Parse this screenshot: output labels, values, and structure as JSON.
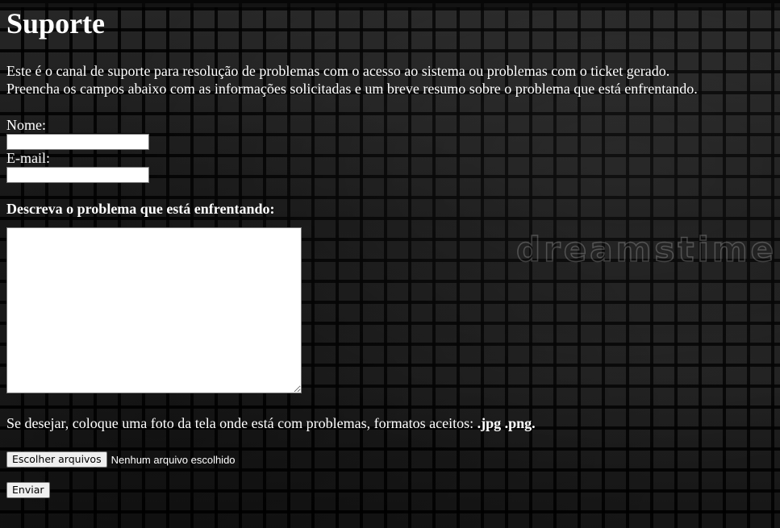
{
  "page": {
    "title": "Suporte",
    "intro_line1": "Este é o canal de suporte para resolução de problemas com o acesso ao sistema ou problemas com o ticket gerado.",
    "intro_line2": "Preencha os campos abaixo com as informações solicitadas e um breve resumo sobre o problema que está enfrentando."
  },
  "form": {
    "name_label": "Nome:",
    "name_value": "",
    "email_label": "E-mail:",
    "email_value": "",
    "problem_label": "Descreva o problema que está enfrentando:",
    "problem_value": "",
    "photo_text": "Se desejar, coloque uma foto da tela onde está com problemas, formatos aceitos: ",
    "photo_formats": ".jpg .png.",
    "file_button_label": "Escolher arquivos",
    "file_status": "Nenhum arquivo escolhido",
    "submit_label": "Enviar"
  },
  "background": {
    "watermark": "dreamstime"
  }
}
